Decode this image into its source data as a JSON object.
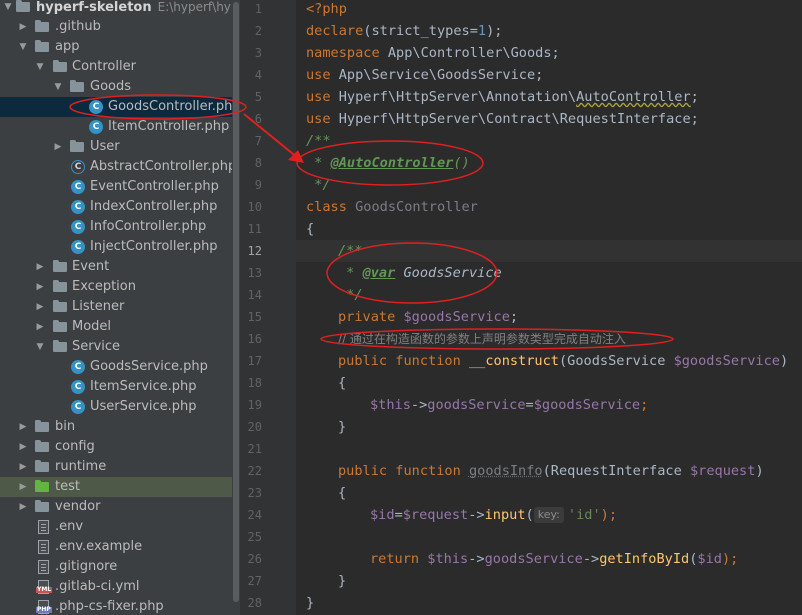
{
  "tree": {
    "root": {
      "label": "hyperf-skeleton",
      "path": "E:\\hyperf\\hyperf-s"
    },
    "items": [
      {
        "label": ".github"
      },
      {
        "label": "app"
      },
      {
        "label": "Controller"
      },
      {
        "label": "Goods"
      },
      {
        "label": "GoodsController.php"
      },
      {
        "label": "ItemController.php"
      },
      {
        "label": "User"
      },
      {
        "label": "AbstractController.php"
      },
      {
        "label": "EventController.php"
      },
      {
        "label": "IndexController.php"
      },
      {
        "label": "InfoController.php"
      },
      {
        "label": "InjectController.php"
      },
      {
        "label": "Event"
      },
      {
        "label": "Exception"
      },
      {
        "label": "Listener"
      },
      {
        "label": "Model"
      },
      {
        "label": "Service"
      },
      {
        "label": "GoodsService.php"
      },
      {
        "label": "ItemService.php"
      },
      {
        "label": "UserService.php"
      },
      {
        "label": "bin"
      },
      {
        "label": "config"
      },
      {
        "label": "runtime"
      },
      {
        "label": "test"
      },
      {
        "label": "vendor"
      },
      {
        "label": ".env"
      },
      {
        "label": ".env.example"
      },
      {
        "label": ".gitignore"
      },
      {
        "label": ".gitlab-ci.yml"
      },
      {
        "label": ".php-cs-fixer.php"
      }
    ]
  },
  "editor": {
    "line_numbers": [
      "1",
      "2",
      "3",
      "4",
      "5",
      "6",
      "7",
      "8",
      "9",
      "10",
      "11",
      "12",
      "13",
      "14",
      "15",
      "16",
      "17",
      "18",
      "19",
      "20",
      "21",
      "22",
      "23",
      "24",
      "25",
      "26",
      "27",
      "28"
    ],
    "current_line": "12",
    "code": {
      "l1": {
        "a": "<?php"
      },
      "l2": {
        "a": "declare",
        "b": "(strict_types=",
        "c": "1",
        "d": ");"
      },
      "l3": {
        "a": "namespace",
        "b": " App\\Controller\\Goods;"
      },
      "l4": {
        "a": "use",
        "b": " App\\Service\\GoodsService;"
      },
      "l5": {
        "a": "use",
        "b": " Hyperf\\HttpServer\\Annotation\\",
        "c": "AutoController",
        "d": ";"
      },
      "l6": {
        "a": "use",
        "b": " Hyperf\\HttpServer\\Contract\\RequestInterface;"
      },
      "l7": {
        "a": "/**"
      },
      "l8": {
        "a": " * ",
        "b": "@AutoController",
        "c": "()"
      },
      "l9": {
        "a": " */"
      },
      "l10": {
        "a": "class",
        "b": " GoodsController"
      },
      "l11": {
        "a": "{"
      },
      "l12": {
        "a": "/**"
      },
      "l13": {
        "a": " * ",
        "b": "@var",
        "c": " GoodsService"
      },
      "l14": {
        "a": " */"
      },
      "l15": {
        "a": "private ",
        "b": "$goodsService",
        "c": ";"
      },
      "l16": {
        "a": "// 通过在构造函数的参数上声明参数类型完成自动注入"
      },
      "l17": {
        "a": "public function ",
        "b": "__construct",
        "c": "(GoodsService ",
        "d": "$goodsService",
        "e": ")"
      },
      "l18": {
        "a": "{"
      },
      "l19": {
        "a": "$this",
        "b": "->",
        "c": "goodsService",
        "d": "=",
        "e": "$goodsService",
        "f": ";"
      },
      "l20": {
        "a": "}"
      },
      "l22": {
        "a": "public function ",
        "b": "goodsInfo",
        "c": "(RequestInterface ",
        "d": "$request",
        "e": ")"
      },
      "l23": {
        "a": "{"
      },
      "l24": {
        "a": "$id",
        "b": "=",
        "c": "$request",
        "d": "->",
        "e": "input",
        "f": "(",
        "g": "key:",
        "h": "'id'",
        "i": ");"
      },
      "l26": {
        "a": "return ",
        "b": "$this",
        "c": "->",
        "d": "goodsService",
        "e": "->",
        "f": "getInfoById",
        "g": "(",
        "h": "$id",
        "i": ");"
      },
      "l27": {
        "a": "}"
      },
      "l28": {
        "a": "}"
      }
    }
  },
  "colors": {
    "tree_bg": "#3c3f41",
    "editor_bg": "#2b2b2b",
    "keyword": "#cc7832",
    "function": "#ffc66d",
    "variable": "#9876aa",
    "doc_comment": "#629755",
    "annotation_red": "#e02020"
  }
}
